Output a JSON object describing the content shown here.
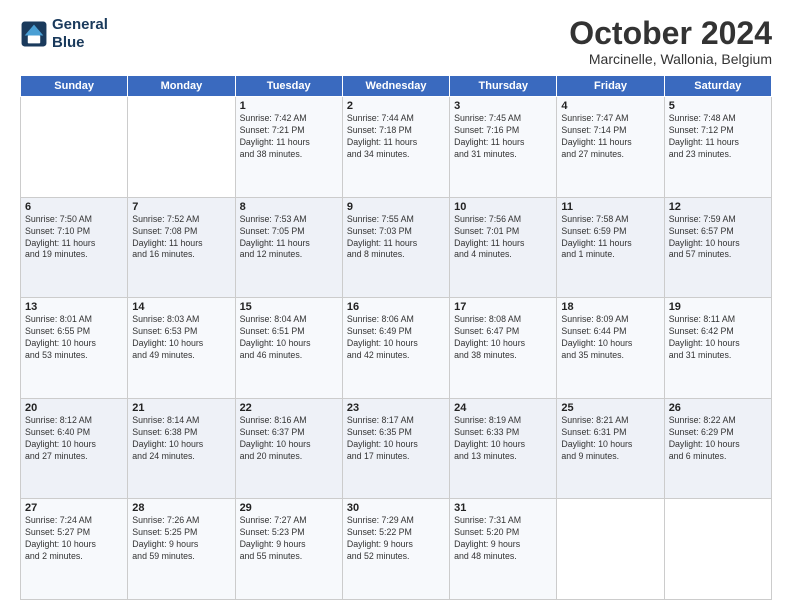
{
  "logo": {
    "line1": "General",
    "line2": "Blue"
  },
  "title": "October 2024",
  "subtitle": "Marcinelle, Wallonia, Belgium",
  "header_days": [
    "Sunday",
    "Monday",
    "Tuesday",
    "Wednesday",
    "Thursday",
    "Friday",
    "Saturday"
  ],
  "weeks": [
    [
      {
        "day": "",
        "info": ""
      },
      {
        "day": "",
        "info": ""
      },
      {
        "day": "1",
        "info": "Sunrise: 7:42 AM\nSunset: 7:21 PM\nDaylight: 11 hours\nand 38 minutes."
      },
      {
        "day": "2",
        "info": "Sunrise: 7:44 AM\nSunset: 7:18 PM\nDaylight: 11 hours\nand 34 minutes."
      },
      {
        "day": "3",
        "info": "Sunrise: 7:45 AM\nSunset: 7:16 PM\nDaylight: 11 hours\nand 31 minutes."
      },
      {
        "day": "4",
        "info": "Sunrise: 7:47 AM\nSunset: 7:14 PM\nDaylight: 11 hours\nand 27 minutes."
      },
      {
        "day": "5",
        "info": "Sunrise: 7:48 AM\nSunset: 7:12 PM\nDaylight: 11 hours\nand 23 minutes."
      }
    ],
    [
      {
        "day": "6",
        "info": "Sunrise: 7:50 AM\nSunset: 7:10 PM\nDaylight: 11 hours\nand 19 minutes."
      },
      {
        "day": "7",
        "info": "Sunrise: 7:52 AM\nSunset: 7:08 PM\nDaylight: 11 hours\nand 16 minutes."
      },
      {
        "day": "8",
        "info": "Sunrise: 7:53 AM\nSunset: 7:05 PM\nDaylight: 11 hours\nand 12 minutes."
      },
      {
        "day": "9",
        "info": "Sunrise: 7:55 AM\nSunset: 7:03 PM\nDaylight: 11 hours\nand 8 minutes."
      },
      {
        "day": "10",
        "info": "Sunrise: 7:56 AM\nSunset: 7:01 PM\nDaylight: 11 hours\nand 4 minutes."
      },
      {
        "day": "11",
        "info": "Sunrise: 7:58 AM\nSunset: 6:59 PM\nDaylight: 11 hours\nand 1 minute."
      },
      {
        "day": "12",
        "info": "Sunrise: 7:59 AM\nSunset: 6:57 PM\nDaylight: 10 hours\nand 57 minutes."
      }
    ],
    [
      {
        "day": "13",
        "info": "Sunrise: 8:01 AM\nSunset: 6:55 PM\nDaylight: 10 hours\nand 53 minutes."
      },
      {
        "day": "14",
        "info": "Sunrise: 8:03 AM\nSunset: 6:53 PM\nDaylight: 10 hours\nand 49 minutes."
      },
      {
        "day": "15",
        "info": "Sunrise: 8:04 AM\nSunset: 6:51 PM\nDaylight: 10 hours\nand 46 minutes."
      },
      {
        "day": "16",
        "info": "Sunrise: 8:06 AM\nSunset: 6:49 PM\nDaylight: 10 hours\nand 42 minutes."
      },
      {
        "day": "17",
        "info": "Sunrise: 8:08 AM\nSunset: 6:47 PM\nDaylight: 10 hours\nand 38 minutes."
      },
      {
        "day": "18",
        "info": "Sunrise: 8:09 AM\nSunset: 6:44 PM\nDaylight: 10 hours\nand 35 minutes."
      },
      {
        "day": "19",
        "info": "Sunrise: 8:11 AM\nSunset: 6:42 PM\nDaylight: 10 hours\nand 31 minutes."
      }
    ],
    [
      {
        "day": "20",
        "info": "Sunrise: 8:12 AM\nSunset: 6:40 PM\nDaylight: 10 hours\nand 27 minutes."
      },
      {
        "day": "21",
        "info": "Sunrise: 8:14 AM\nSunset: 6:38 PM\nDaylight: 10 hours\nand 24 minutes."
      },
      {
        "day": "22",
        "info": "Sunrise: 8:16 AM\nSunset: 6:37 PM\nDaylight: 10 hours\nand 20 minutes."
      },
      {
        "day": "23",
        "info": "Sunrise: 8:17 AM\nSunset: 6:35 PM\nDaylight: 10 hours\nand 17 minutes."
      },
      {
        "day": "24",
        "info": "Sunrise: 8:19 AM\nSunset: 6:33 PM\nDaylight: 10 hours\nand 13 minutes."
      },
      {
        "day": "25",
        "info": "Sunrise: 8:21 AM\nSunset: 6:31 PM\nDaylight: 10 hours\nand 9 minutes."
      },
      {
        "day": "26",
        "info": "Sunrise: 8:22 AM\nSunset: 6:29 PM\nDaylight: 10 hours\nand 6 minutes."
      }
    ],
    [
      {
        "day": "27",
        "info": "Sunrise: 7:24 AM\nSunset: 5:27 PM\nDaylight: 10 hours\nand 2 minutes."
      },
      {
        "day": "28",
        "info": "Sunrise: 7:26 AM\nSunset: 5:25 PM\nDaylight: 9 hours\nand 59 minutes."
      },
      {
        "day": "29",
        "info": "Sunrise: 7:27 AM\nSunset: 5:23 PM\nDaylight: 9 hours\nand 55 minutes."
      },
      {
        "day": "30",
        "info": "Sunrise: 7:29 AM\nSunset: 5:22 PM\nDaylight: 9 hours\nand 52 minutes."
      },
      {
        "day": "31",
        "info": "Sunrise: 7:31 AM\nSunset: 5:20 PM\nDaylight: 9 hours\nand 48 minutes."
      },
      {
        "day": "",
        "info": ""
      },
      {
        "day": "",
        "info": ""
      }
    ]
  ]
}
